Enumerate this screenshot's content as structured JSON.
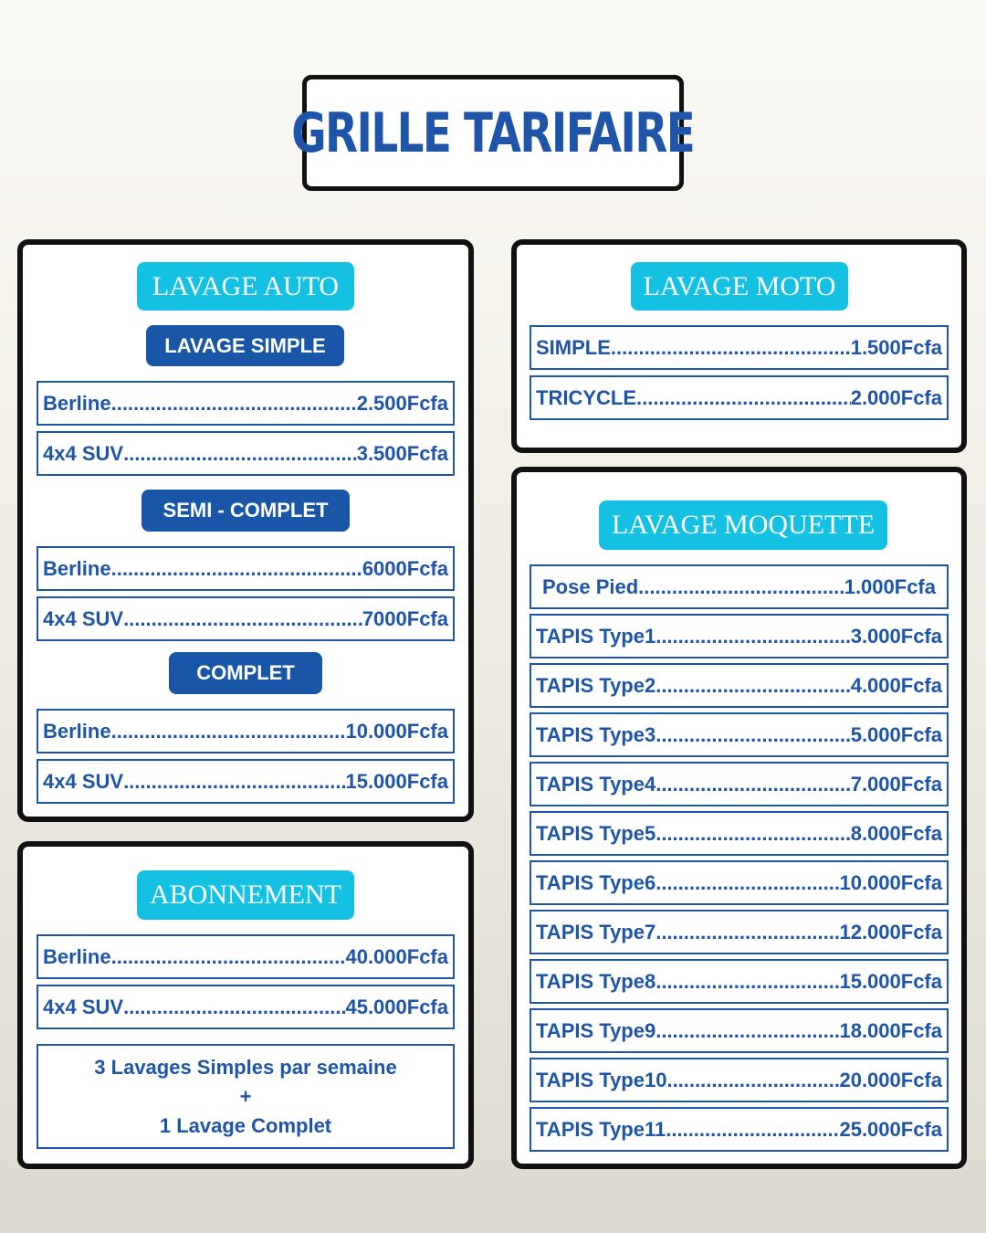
{
  "title": "GRILLE TARIFAIRE",
  "auto": {
    "header": "LAVAGE AUTO",
    "sections": [
      {
        "label": "LAVAGE SIMPLE",
        "rows": [
          {
            "name": "Berline",
            "price": "2.500Fcfa"
          },
          {
            "name": "4x4 SUV",
            "price": "3.500Fcfa"
          }
        ]
      },
      {
        "label": "SEMI - COMPLET",
        "rows": [
          {
            "name": "Berline",
            "price": "6000Fcfa"
          },
          {
            "name": "4x4 SUV",
            "price": "7000Fcfa"
          }
        ]
      },
      {
        "label": "COMPLET",
        "rows": [
          {
            "name": "Berline",
            "price": "10.000Fcfa"
          },
          {
            "name": "4x4 SUV",
            "price": "15.000Fcfa"
          }
        ]
      }
    ]
  },
  "abonnement": {
    "header": "ABONNEMENT",
    "rows": [
      {
        "name": "Berline",
        "price": "40.000Fcfa"
      },
      {
        "name": "4x4 SUV",
        "price": "45.000Fcfa"
      }
    ],
    "note": [
      "3 Lavages Simples par semaine",
      "+",
      "1 Lavage Complet"
    ]
  },
  "moto": {
    "header": "LAVAGE MOTO",
    "rows": [
      {
        "name": "SIMPLE",
        "price": "1.500Fcfa"
      },
      {
        "name": "TRICYCLE",
        "price": "2.000Fcfa"
      }
    ]
  },
  "moquette": {
    "header": "LAVAGE MOQUETTE",
    "rows": [
      {
        "name": "Pose Pied",
        "price": "1.000Fcfa"
      },
      {
        "name": "TAPIS Type1",
        "price": "3.000Fcfa"
      },
      {
        "name": "TAPIS Type2",
        "price": "4.000Fcfa"
      },
      {
        "name": "TAPIS Type3",
        "price": "5.000Fcfa"
      },
      {
        "name": "TAPIS Type4",
        "price": "7.000Fcfa"
      },
      {
        "name": "TAPIS Type5",
        "price": "8.000Fcfa"
      },
      {
        "name": "TAPIS Type6",
        "price": "10.000Fcfa"
      },
      {
        "name": "TAPIS Type7",
        "price": "12.000Fcfa"
      },
      {
        "name": "TAPIS Type8",
        "price": "15.000Fcfa"
      },
      {
        "name": "TAPIS Type9",
        "price": "18.000Fcfa"
      },
      {
        "name": "TAPIS Type10",
        "price": "20.000Fcfa"
      },
      {
        "name": "TAPIS Type11",
        "price": "25.000Fcfa"
      }
    ]
  },
  "colors": {
    "cyan": "#14c1e2",
    "blue": "#1a56a7",
    "border": "#111111"
  }
}
